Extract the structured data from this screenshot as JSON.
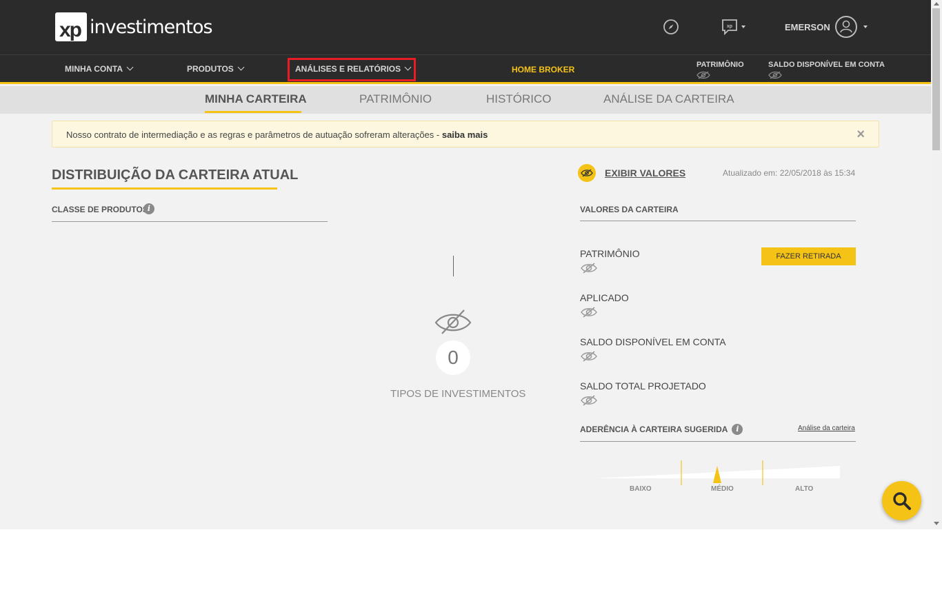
{
  "brand": {
    "logo_mark": "xp",
    "logo_word": "investimentos"
  },
  "header": {
    "icons": [
      "compass-icon",
      "chat-xp-icon"
    ],
    "user_name": "EMERSON"
  },
  "nav": {
    "minha_conta": "MINHA CONTA",
    "produtos": "PRODUTOS",
    "analises": "ANÁLISES E RELATÓRIOS",
    "home_broker": "HOME BROKER",
    "patrimonio": "PATRIMÔNIO",
    "saldo": "SALDO DISPONÍVEL EM CONTA"
  },
  "tabs": [
    {
      "label": "MINHA CARTEIRA",
      "active": true
    },
    {
      "label": "PATRIMÔNIO",
      "active": false
    },
    {
      "label": "HISTÓRICO",
      "active": false
    },
    {
      "label": "ANÁLISE DA CARTEIRA",
      "active": false
    }
  ],
  "notice": {
    "text": "Nosso contrato de intermediação e as regras e parâmetros de autuação sofreram alterações - ",
    "link": "saiba mais",
    "close": "×"
  },
  "main": {
    "title": "DISTRIBUIÇÃO DA CARTEIRA ATUAL",
    "classe_label": "CLASSE DE PRODUTOS",
    "info": "i",
    "investment_count": "0",
    "investment_count_label": "TIPOS DE INVESTIMENTOS"
  },
  "right": {
    "exibir": "EXIBIR VALORES",
    "atualizado": "Atualizado em: 22/05/2018 às 15:34",
    "valores_label": "VALORES DA CARTEIRA",
    "items": [
      {
        "label": "PATRIMÔNIO"
      },
      {
        "label": "APLICADO"
      },
      {
        "label": "SALDO DISPONÍVEL EM CONTA"
      },
      {
        "label": "SALDO TOTAL PROJETADO"
      }
    ],
    "retirada_button": "FAZER RETIRADA",
    "aderencia_label": "ADERÊNCIA À CARTEIRA SUGERIDA",
    "analise_link": "Análise da carteira",
    "gauge": {
      "labels": [
        "BAIXO",
        "MÉDIO",
        "ALTO"
      ],
      "level": "MÉDIO"
    }
  },
  "colors": {
    "accent": "#f5c315",
    "dark": "#2b2b2b",
    "highlight": "#e81c24"
  }
}
